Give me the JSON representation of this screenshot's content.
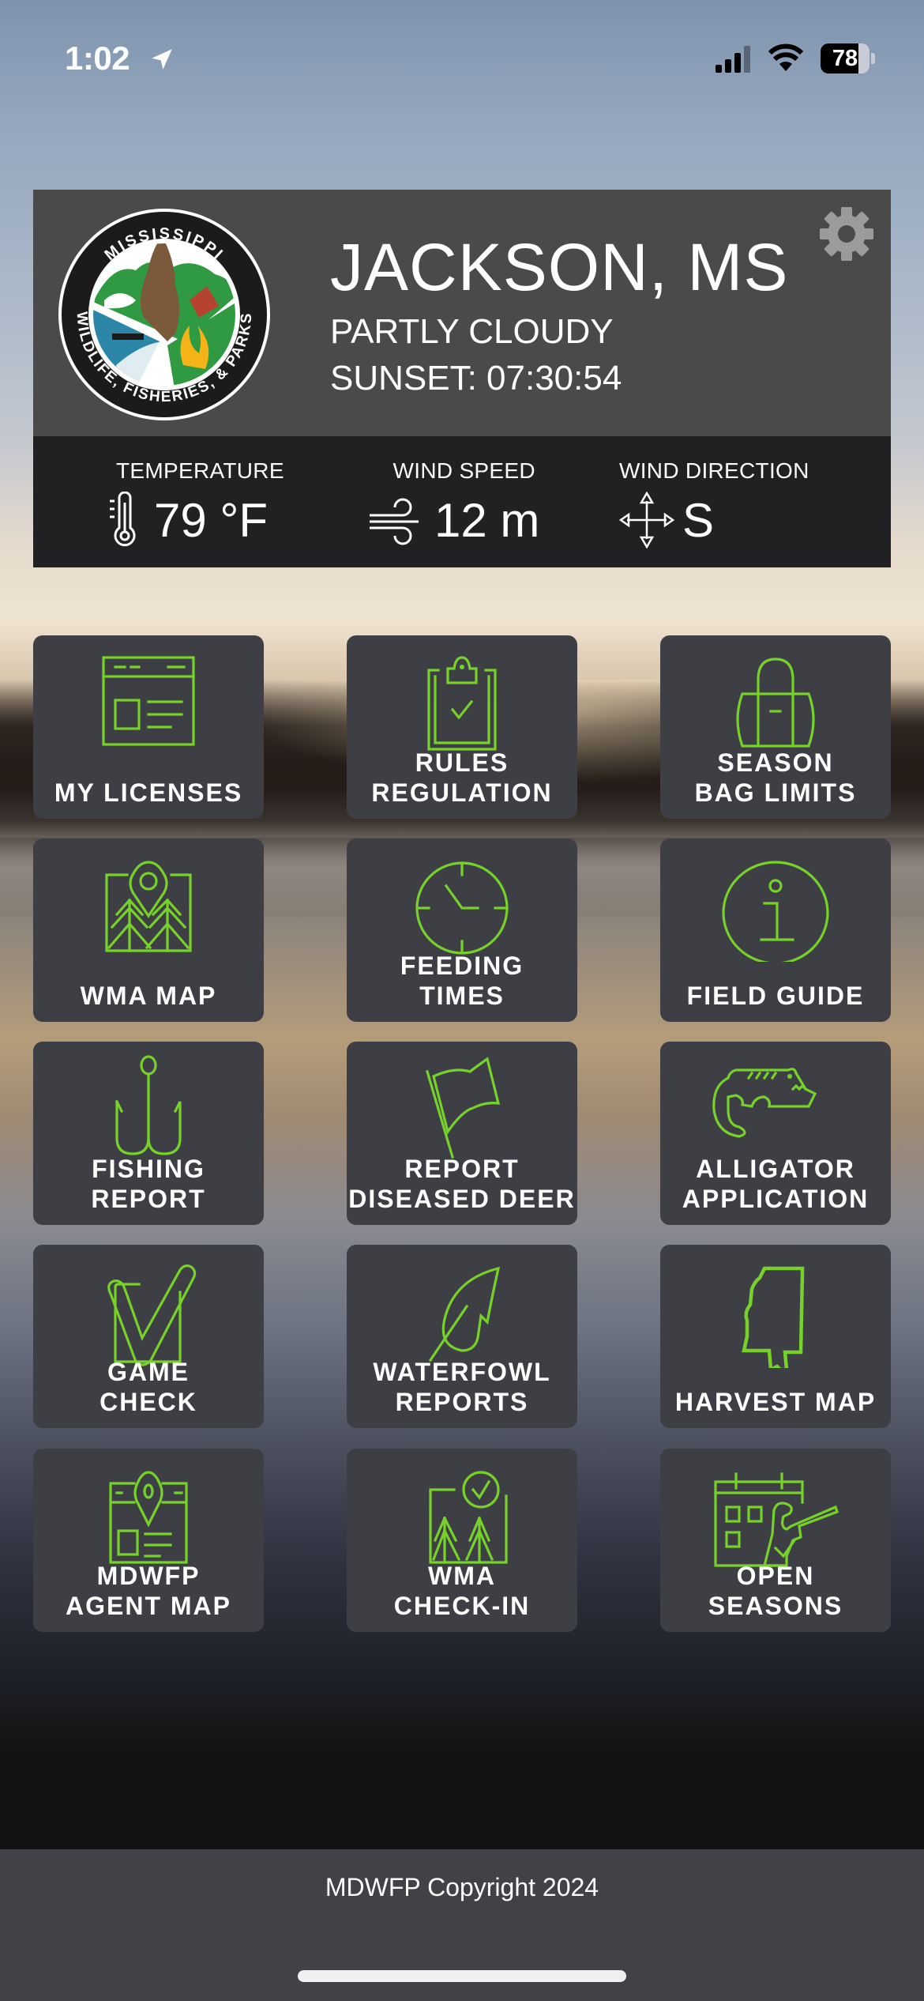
{
  "status_bar": {
    "time": "1:02",
    "location_icon": "location-arrow-icon",
    "signal_icon": "cellular-signal-icon",
    "wifi_icon": "wifi-icon",
    "battery_percent": 78,
    "battery_label": "78"
  },
  "header": {
    "logo_name": "mississippi-wildlife-fisheries-parks-logo",
    "logo_text_top": "MISSISSIPPI",
    "logo_text_bottom": "WILDLIFE, FISHERIES, & PARKS",
    "city": "JACKSON, MS",
    "condition": "PARTLY CLOUDY",
    "sunset": "SUNSET: 07:30:54",
    "settings_icon": "gear-icon"
  },
  "weather": {
    "temperature": {
      "label": "TEMPERATURE",
      "value": "79 °F",
      "icon": "thermometer-icon"
    },
    "wind_speed": {
      "label": "WIND SPEED",
      "value": "12 m",
      "icon": "wind-icon"
    },
    "wind_direction": {
      "label": "WIND DIRECTION",
      "value": "S",
      "icon": "compass-arrows-icon"
    }
  },
  "colors": {
    "accent_green": "#76d22a",
    "tile_background": "#3e3f45",
    "header_background": "#4a4a4b",
    "weather_background": "#212124",
    "footer_background": "#414247"
  },
  "tiles": [
    {
      "label": "MY LICENSES",
      "icon": "license-card-icon"
    },
    {
      "label": "RULES\nREGULATION",
      "icon": "clipboard-check-icon"
    },
    {
      "label": "SEASON\nBAG LIMITS",
      "icon": "duffel-bag-icon"
    },
    {
      "label": "WMA MAP",
      "icon": "map-pin-trees-icon"
    },
    {
      "label": "FEEDING\nTIMES",
      "icon": "clock-icon"
    },
    {
      "label": "FIELD GUIDE",
      "icon": "info-circle-icon"
    },
    {
      "label": "FISHING\nREPORT",
      "icon": "fish-hook-icon"
    },
    {
      "label": "REPORT\nDISEASED DEER",
      "icon": "flag-icon"
    },
    {
      "label": "ALLIGATOR\nAPPLICATION",
      "icon": "alligator-icon"
    },
    {
      "label": "GAME\nCHECK",
      "icon": "checkbox-check-icon"
    },
    {
      "label": "WATERFOWL\nREPORTS",
      "icon": "feather-icon"
    },
    {
      "label": "HARVEST MAP",
      "icon": "mississippi-state-outline-icon"
    },
    {
      "label": "MDWFP\nAGENT MAP",
      "icon": "agent-map-pin-icon"
    },
    {
      "label": "WMA\nCHECK-IN",
      "icon": "trees-check-icon"
    },
    {
      "label": "OPEN\nSEASONS",
      "icon": "calendar-hunter-icon"
    }
  ],
  "footer": {
    "copyright": "MDWFP Copyright 2024"
  }
}
